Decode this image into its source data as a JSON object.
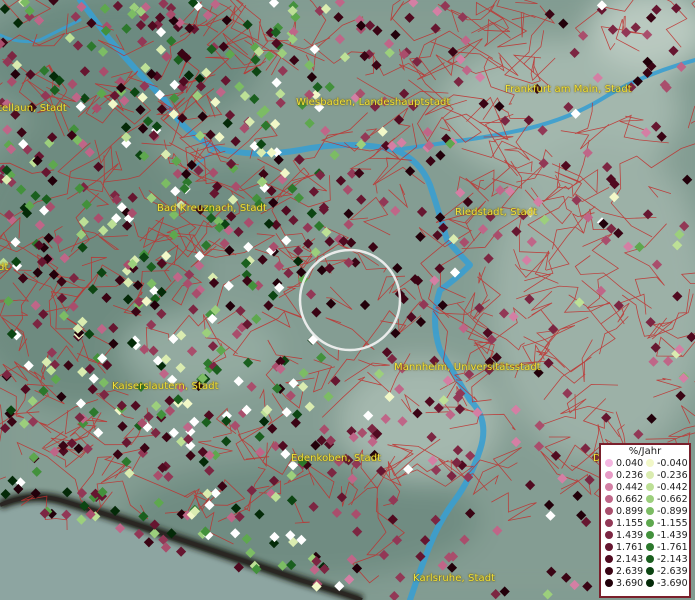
{
  "cities": [
    {
      "name": "Frankfurt am Main, Stadt"
    },
    {
      "name": "Wiesbaden, Landeshauptstadt"
    },
    {
      "name": "Bad Kreuznach, Stadt"
    },
    {
      "name": "Riedstadt, Stadt"
    },
    {
      "name": "Mannheim, Universitätsstadt"
    },
    {
      "name": "Kaiserslautern, Stadt"
    },
    {
      "name": "Edenkoben, Stadt"
    },
    {
      "name": "Karlsruhe, Stadt"
    },
    {
      "name": "tellaun, Stadt"
    },
    {
      "name": "dt"
    },
    {
      "name": "D"
    }
  ],
  "legend": {
    "title": "%/Jahr",
    "positive": [
      {
        "label": "0.040",
        "color": "#f4b6e0"
      },
      {
        "label": "0.236",
        "color": "#e79ac5"
      },
      {
        "label": "0.442",
        "color": "#d47fa4"
      },
      {
        "label": "0.662",
        "color": "#bf6688"
      },
      {
        "label": "0.899",
        "color": "#a94e6c"
      },
      {
        "label": "1.155",
        "color": "#923856"
      },
      {
        "label": "1.439",
        "color": "#7c2642"
      },
      {
        "label": "1.761",
        "color": "#661630"
      },
      {
        "label": "2.143",
        "color": "#500a20"
      },
      {
        "label": "2.639",
        "color": "#3a0414"
      },
      {
        "label": "3.690",
        "color": "#22000a"
      }
    ],
    "negative": [
      {
        "label": "-0.040",
        "color": "#f2f8c8"
      },
      {
        "label": "-0.236",
        "color": "#daecb0"
      },
      {
        "label": "-0.442",
        "color": "#bde096"
      },
      {
        "label": "-0.662",
        "color": "#9ccf7c"
      },
      {
        "label": "-0.899",
        "color": "#7cbc64"
      },
      {
        "label": "-1.155",
        "color": "#5ea84e"
      },
      {
        "label": "-1.439",
        "color": "#43913c"
      },
      {
        "label": "-1.761",
        "color": "#2c782c"
      },
      {
        "label": "-2.143",
        "color": "#1a5f1e"
      },
      {
        "label": "-2.639",
        "color": "#0c4512"
      },
      {
        "label": "-3.690",
        "color": "#042a08"
      }
    ]
  },
  "colors": {
    "terrain": "#7f9a90",
    "river": "#3a9fd0",
    "boundaries": "#c0302e",
    "coast": "#1c1a18",
    "water_body": "#8fa6a2",
    "white_points": "#ffffff"
  }
}
